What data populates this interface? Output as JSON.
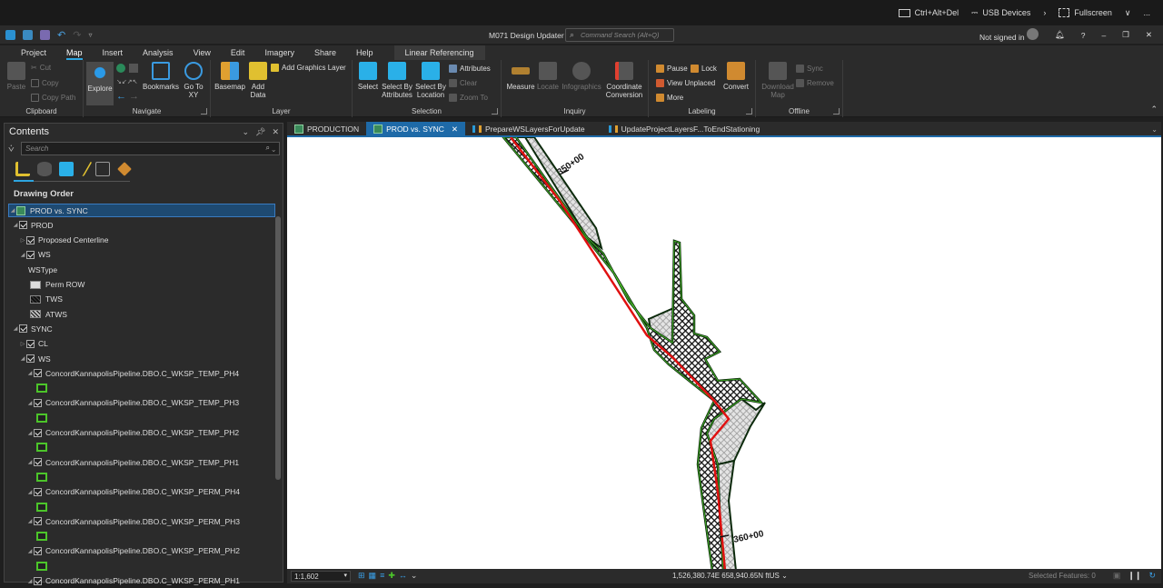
{
  "vm_bar": {
    "ctrl_alt_del": "Ctrl+Alt+Del",
    "usb": "USB Devices",
    "fullscreen": "Fullscreen",
    "more": "..."
  },
  "app": {
    "title": "M071 Design Updater",
    "command_search_placeholder": "Command Search (Alt+Q)",
    "sign_in": "Not signed in"
  },
  "ribbon_tabs": [
    "Project",
    "Map",
    "Insert",
    "Analysis",
    "View",
    "Edit",
    "Imagery",
    "Share",
    "Help",
    "Linear Referencing"
  ],
  "ribbon": {
    "clipboard": {
      "label": "Clipboard",
      "paste": "Paste",
      "cut": "Cut",
      "copy": "Copy",
      "copy_path": "Copy Path"
    },
    "navigate": {
      "label": "Navigate",
      "explore": "Explore",
      "bookmarks": "Bookmarks",
      "go_to_xy": "Go To XY"
    },
    "layer": {
      "label": "Layer",
      "basemap": "Basemap",
      "add_data": "Add Data",
      "add_graphics_layer": "Add Graphics Layer"
    },
    "selection": {
      "label": "Selection",
      "select": "Select",
      "select_by_attributes": "Select By Attributes",
      "select_by_location": "Select By Location",
      "attributes": "Attributes",
      "clear": "Clear",
      "zoom_to": "Zoom To"
    },
    "inquiry": {
      "label": "Inquiry",
      "measure": "Measure",
      "locate": "Locate",
      "infographics": "Infographics",
      "coordinate_conversion": "Coordinate Conversion"
    },
    "labeling": {
      "label": "Labeling",
      "pause": "Pause",
      "lock": "Lock",
      "view_unplaced": "View Unplaced",
      "more": "More",
      "convert": "Convert"
    },
    "offline": {
      "label": "Offline",
      "download_map": "Download Map",
      "sync": "Sync",
      "remove": "Remove"
    }
  },
  "contents": {
    "title": "Contents",
    "search_placeholder": "Search",
    "drawing_order": "Drawing Order",
    "map_name": "PROD vs. SYNC",
    "items": [
      {
        "label": "PROD",
        "indent": 1,
        "checked": true
      },
      {
        "label": "Proposed Centerline",
        "indent": 2,
        "checked": true
      },
      {
        "label": "WS",
        "indent": 2,
        "checked": true
      },
      {
        "label": "WSType",
        "indent": 3,
        "type": "heading"
      },
      {
        "label": "Perm ROW",
        "indent": 3,
        "type": "legend",
        "swatch": "perm"
      },
      {
        "label": "TWS",
        "indent": 3,
        "type": "legend",
        "swatch": "tws"
      },
      {
        "label": "ATWS",
        "indent": 3,
        "type": "legend",
        "swatch": "atws"
      },
      {
        "label": "SYNC",
        "indent": 1,
        "checked": true
      },
      {
        "label": "CL",
        "indent": 2,
        "checked": true
      },
      {
        "label": "WS",
        "indent": 2,
        "checked": true
      },
      {
        "label": "ConcordKannapolisPipeline.DBO.C_WKSP_TEMP_PH4",
        "indent": 3,
        "checked": true
      },
      {
        "label": "",
        "indent": 3,
        "type": "green"
      },
      {
        "label": "ConcordKannapolisPipeline.DBO.C_WKSP_TEMP_PH3",
        "indent": 3,
        "checked": true
      },
      {
        "label": "",
        "indent": 3,
        "type": "green"
      },
      {
        "label": "ConcordKannapolisPipeline.DBO.C_WKSP_TEMP_PH2",
        "indent": 3,
        "checked": true
      },
      {
        "label": "",
        "indent": 3,
        "type": "green"
      },
      {
        "label": "ConcordKannapolisPipeline.DBO.C_WKSP_TEMP_PH1",
        "indent": 3,
        "checked": true
      },
      {
        "label": "",
        "indent": 3,
        "type": "green"
      },
      {
        "label": "ConcordKannapolisPipeline.DBO.C_WKSP_PERM_PH4",
        "indent": 3,
        "checked": true
      },
      {
        "label": "",
        "indent": 3,
        "type": "green"
      },
      {
        "label": "ConcordKannapolisPipeline.DBO.C_WKSP_PERM_PH3",
        "indent": 3,
        "checked": true
      },
      {
        "label": "",
        "indent": 3,
        "type": "green"
      },
      {
        "label": "ConcordKannapolisPipeline.DBO.C_WKSP_PERM_PH2",
        "indent": 3,
        "checked": true
      },
      {
        "label": "",
        "indent": 3,
        "type": "green"
      },
      {
        "label": "ConcordKannapolisPipeline.DBO.C_WKSP_PERM_PH1",
        "indent": 3,
        "checked": true
      }
    ]
  },
  "map_tabs": [
    {
      "label": "PRODUCTION",
      "kind": "map",
      "active": false
    },
    {
      "label": "PROD vs. SYNC",
      "kind": "map",
      "active": true
    },
    {
      "label": "PrepareWSLayersForUpdate",
      "kind": "model",
      "active": false
    },
    {
      "label": "UpdateProjectLayersF...ToEndStationing",
      "kind": "model",
      "active": false
    }
  ],
  "map": {
    "station_labels": [
      "350+00",
      "360+00"
    ],
    "colors": {
      "centerline": "#e01010",
      "outline": "#0c2a0c",
      "green_edge": "#4cc52a"
    }
  },
  "status": {
    "scale": "1:1,602",
    "coordinates": "1,526,380.74E 658,940.65N ftUS",
    "selected_features": "Selected Features: 0"
  }
}
